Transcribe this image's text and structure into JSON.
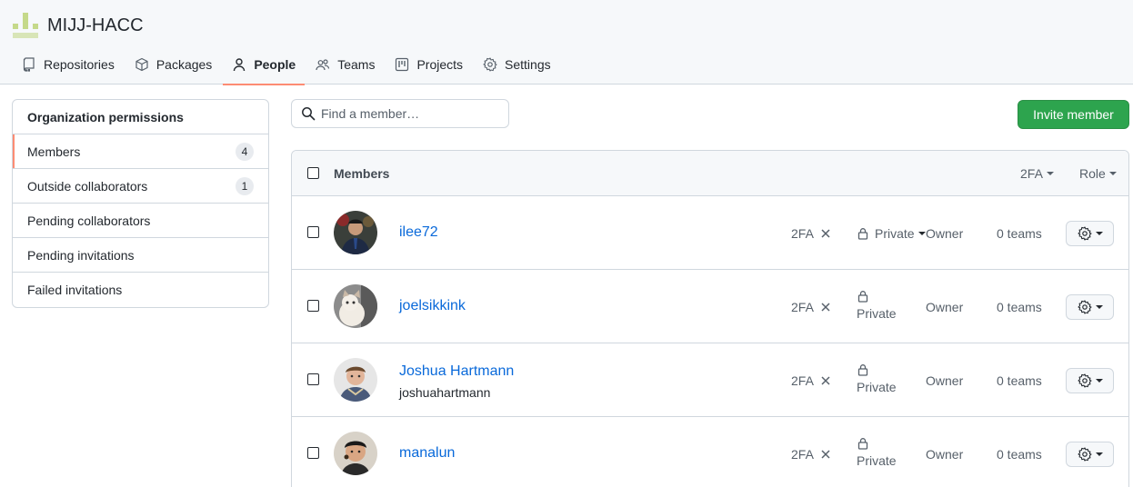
{
  "org": {
    "name": "MIJJ-HACC"
  },
  "tabs": [
    {
      "label": "Repositories",
      "icon": "repo-icon"
    },
    {
      "label": "Packages",
      "icon": "package-icon"
    },
    {
      "label": "People",
      "icon": "person-icon",
      "active": true
    },
    {
      "label": "Teams",
      "icon": "people-icon"
    },
    {
      "label": "Projects",
      "icon": "project-icon"
    },
    {
      "label": "Settings",
      "icon": "gear-icon"
    }
  ],
  "sidebar": {
    "heading": "Organization permissions",
    "items": [
      {
        "label": "Members",
        "count": "4",
        "selected": true
      },
      {
        "label": "Outside collaborators",
        "count": "1"
      },
      {
        "label": "Pending collaborators"
      },
      {
        "label": "Pending invitations"
      },
      {
        "label": "Failed invitations"
      }
    ]
  },
  "search": {
    "placeholder": "Find a member…"
  },
  "invite_label": "Invite member",
  "table": {
    "title": "Members",
    "filter_2fa": "2FA",
    "filter_role": "Role",
    "members": [
      {
        "name": "ilee72",
        "login": "",
        "twofa": "2FA",
        "visibility": "Private",
        "role": "Owner",
        "teams": "0 teams"
      },
      {
        "name": "joelsikkink",
        "login": "",
        "twofa": "2FA",
        "visibility": "Private",
        "role": "Owner",
        "teams": "0 teams"
      },
      {
        "name": "Joshua Hartmann",
        "login": "joshuahartmann",
        "twofa": "2FA",
        "visibility": "Private",
        "role": "Owner",
        "teams": "0 teams"
      },
      {
        "name": "manalun",
        "login": "",
        "twofa": "2FA",
        "visibility": "Private",
        "role": "Owner",
        "teams": "0 teams"
      }
    ]
  },
  "colors": {
    "accent_underline": "#fd8c73",
    "invite_green": "#2da44e",
    "link_blue": "#0969da"
  }
}
